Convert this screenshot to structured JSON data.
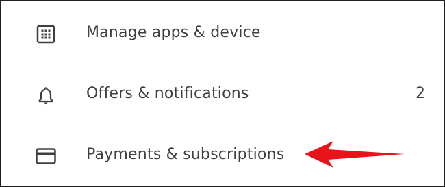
{
  "menu": {
    "items": [
      {
        "label": "Manage apps & device",
        "icon": "grid-apps-icon"
      },
      {
        "label": "Offers & notifications",
        "icon": "bell-icon",
        "count": "2"
      },
      {
        "label": "Payments & subscriptions",
        "icon": "credit-card-icon"
      }
    ]
  },
  "annotation": {
    "arrow_color": "#e8141a",
    "points_to": "Payments & subscriptions"
  },
  "colors": {
    "text": "#3c4043",
    "icon": "#3c4043",
    "background": "#ffffff"
  }
}
